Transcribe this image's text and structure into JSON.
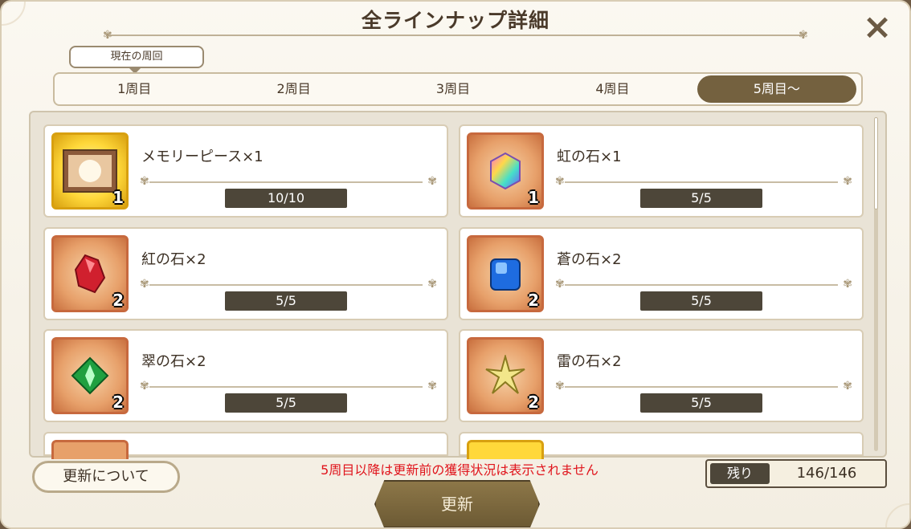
{
  "header": {
    "title": "全ラインナップ詳細",
    "close_icon": "×"
  },
  "current_cycle_label": "現在の周回",
  "tabs": [
    {
      "label": "1周目",
      "active": false
    },
    {
      "label": "2周目",
      "active": false
    },
    {
      "label": "3周目",
      "active": false
    },
    {
      "label": "4周目",
      "active": false
    },
    {
      "label": "5周目〜",
      "active": true
    }
  ],
  "items": [
    {
      "name": "メモリーピース×1",
      "count": "1",
      "progress": "10/10",
      "icon": "memory-piece-icon",
      "frame": "gold"
    },
    {
      "name": "虹の石×1",
      "count": "1",
      "progress": "5/5",
      "icon": "rainbow-stone-icon",
      "frame": "bronze"
    },
    {
      "name": "紅の石×2",
      "count": "2",
      "progress": "5/5",
      "icon": "red-stone-icon",
      "frame": "bronze"
    },
    {
      "name": "蒼の石×2",
      "count": "2",
      "progress": "5/5",
      "icon": "blue-stone-icon",
      "frame": "bronze"
    },
    {
      "name": "翠の石×2",
      "count": "2",
      "progress": "5/5",
      "icon": "green-stone-icon",
      "frame": "bronze"
    },
    {
      "name": "雷の石×2",
      "count": "2",
      "progress": "5/5",
      "icon": "thunder-stone-icon",
      "frame": "bronze"
    }
  ],
  "footer": {
    "about_label": "更新について",
    "notice": "5周目以降は更新前の獲得状況は表示されません",
    "remain_label": "残り",
    "remain_value": "146/146",
    "update_label": "更新"
  },
  "colors": {
    "accent_dark": "#74613f",
    "progress_bg": "#4d4639",
    "notice": "#e0141c"
  }
}
